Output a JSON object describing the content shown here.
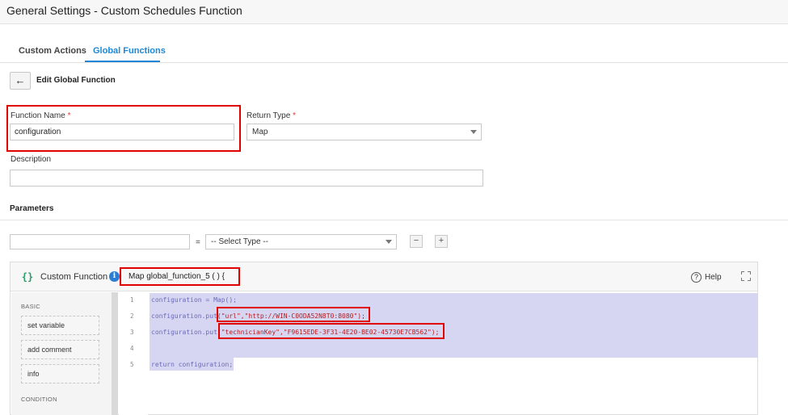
{
  "header": {
    "title": "General Settings - Custom Schedules Function"
  },
  "tabs": [
    {
      "label": "Custom Actions",
      "active": false
    },
    {
      "label": "Global Functions",
      "active": true
    }
  ],
  "page": {
    "back_icon": "arrow-left-icon",
    "title": "Edit Global Function"
  },
  "form": {
    "function_name": {
      "label": "Function Name",
      "required_mark": "*",
      "value": "configuration"
    },
    "return_type": {
      "label": "Return Type",
      "required_mark": "*",
      "value": "Map"
    },
    "description": {
      "label": "Description",
      "value": ""
    }
  },
  "parameters": {
    "title": "Parameters",
    "name_value": "",
    "equals": "=",
    "type_select": "-- Select Type --",
    "remove_label": "−",
    "add_label": "+"
  },
  "editor": {
    "icon_glyph": "{}",
    "label": "Custom Function",
    "signature": "Map global_function_5 ( ) {",
    "help_label": "Help",
    "sidebar": {
      "basic_heading": "BASIC",
      "items": [
        "set variable",
        "add comment",
        "info"
      ],
      "condition_heading": "CONDITION"
    },
    "line_numbers": [
      "1",
      "2",
      "3",
      "4",
      "5"
    ],
    "code": {
      "line1": "configuration = Map();",
      "line2_prefix": "configuration.put",
      "line2_args": "(\"url\",\"http://WIN-C0ODA52N8T0:8080\");",
      "line3_prefix": "configuration.put",
      "line3_args": "(\"technicianKey\",\"F9615EDE-3F31-4E20-BE02-45730E7CB562\");",
      "line5": "return configuration;"
    }
  },
  "colors": {
    "accent": "#1e88d6",
    "highlight_box": "#e00000",
    "selection": "#d6d6f2",
    "code_text": "#6a6ab8"
  }
}
